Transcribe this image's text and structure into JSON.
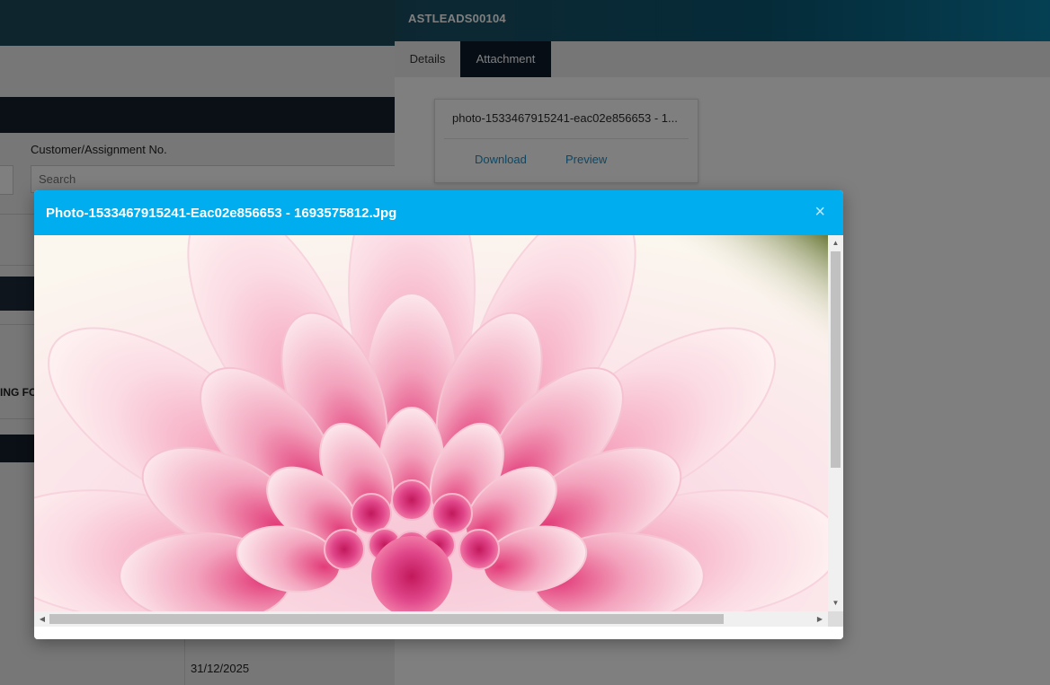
{
  "background": {
    "filter_label": "Customer/Assignment No.",
    "search_placeholder": "Search",
    "cut_text": "ING FO",
    "date_value": "31/12/2025"
  },
  "panel": {
    "title": "ASTLEADS00104",
    "tabs": [
      {
        "label": "Details",
        "active": false
      },
      {
        "label": "Attachment",
        "active": true
      }
    ],
    "attachment": {
      "filename": "photo-1533467915241-eac02e856653 - 1...",
      "download_label": "Download",
      "preview_label": "Preview"
    }
  },
  "modal": {
    "title": "Photo-1533467915241-Eac02e856653 - 1693575812.Jpg",
    "close_glyph": "×",
    "image_subject": "pink dahlia flower",
    "scroll_up_glyph": "▲",
    "scroll_down_glyph": "▼",
    "scroll_left_glyph": "◀",
    "scroll_right_glyph": "▶"
  },
  "colors": {
    "modal_header": "#00adee",
    "panel_header": "#0b5570",
    "active_tab": "#0c1b2a",
    "link": "#1a8fc9"
  }
}
